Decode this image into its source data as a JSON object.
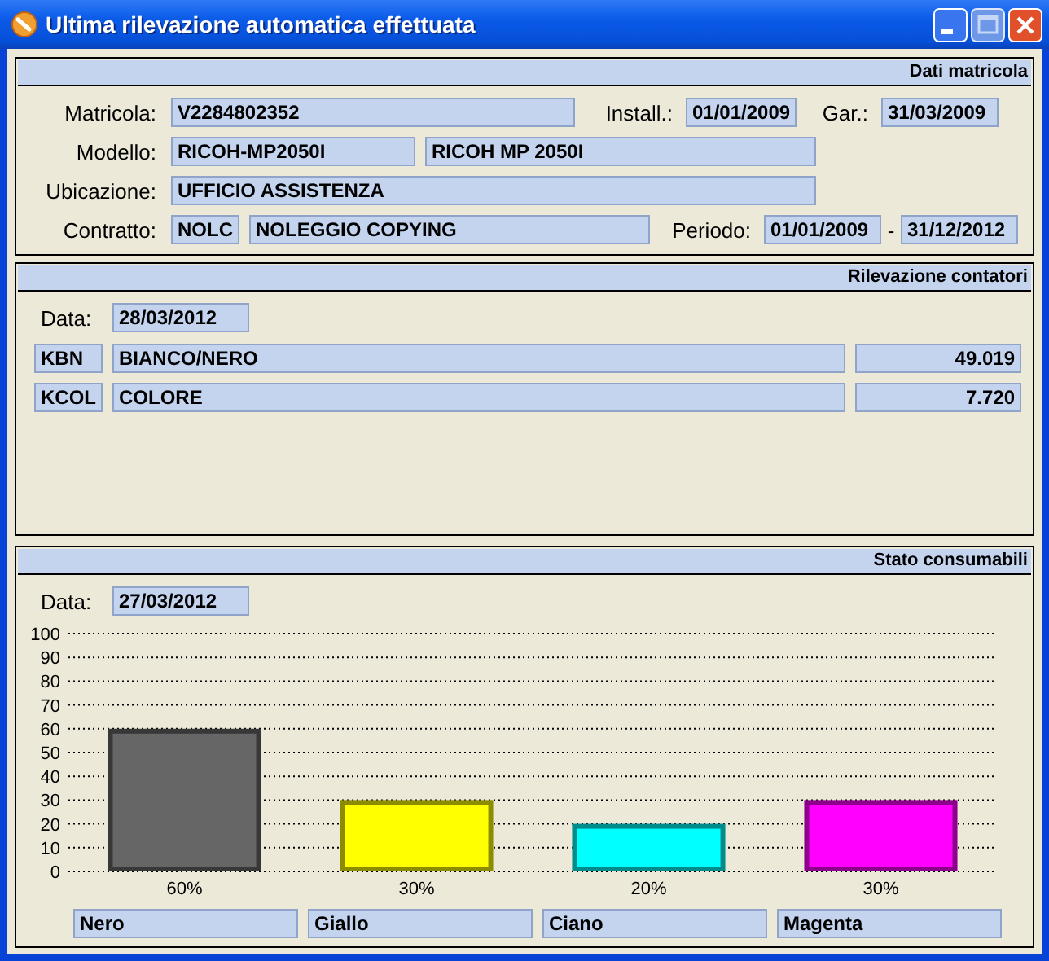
{
  "window": {
    "title": "Ultima rilevazione automatica effettuata"
  },
  "dati_matricola": {
    "title": "Dati matricola",
    "matricola": {
      "label": "Matricola:",
      "value": "V2284802352"
    },
    "install": {
      "label": "Install.:",
      "value": "01/01/2009"
    },
    "gar": {
      "label": "Gar.:",
      "value": "31/03/2009"
    },
    "modello": {
      "label": "Modello:",
      "code": "RICOH-MP2050I",
      "description": "RICOH MP 2050I"
    },
    "ubicazione": {
      "label": "Ubicazione:",
      "value": "UFFICIO ASSISTENZA"
    },
    "contratto": {
      "label": "Contratto:",
      "code": "NOLC",
      "description": "NOLEGGIO COPYING"
    },
    "periodo": {
      "label": "Periodo:",
      "from": "01/01/2009",
      "separator": "-",
      "to": "31/12/2012"
    }
  },
  "rilevazione_contatori": {
    "title": "Rilevazione contatori",
    "date_label": "Data:",
    "date": "28/03/2012",
    "rows": [
      {
        "code": "KBN",
        "description": "BIANCO/NERO",
        "value": "49.019"
      },
      {
        "code": "KCOL",
        "description": "COLORE",
        "value": "7.720"
      }
    ]
  },
  "stato_consumabili": {
    "title": "Stato consumabili",
    "date_label": "Data:",
    "date": "27/03/2012",
    "chart_data": {
      "type": "bar",
      "categories": [
        "60%",
        "30%",
        "20%",
        "30%"
      ],
      "series": [
        {
          "name": "Nero",
          "color": "#666666",
          "values": [
            60,
            null,
            null,
            null
          ]
        },
        {
          "name": "Giallo",
          "color": "#ffff00",
          "values": [
            null,
            30,
            null,
            null
          ]
        },
        {
          "name": "Ciano",
          "color": "#00ffff",
          "values": [
            null,
            null,
            20,
            null
          ]
        },
        {
          "name": "Magenta",
          "color": "#ff00ff",
          "values": [
            null,
            null,
            null,
            30
          ]
        }
      ],
      "stacked": true,
      "grid": true,
      "ylim": [
        0,
        100
      ],
      "yticks": [
        0,
        10,
        20,
        30,
        40,
        50,
        60,
        70,
        80,
        90,
        100
      ]
    }
  }
}
